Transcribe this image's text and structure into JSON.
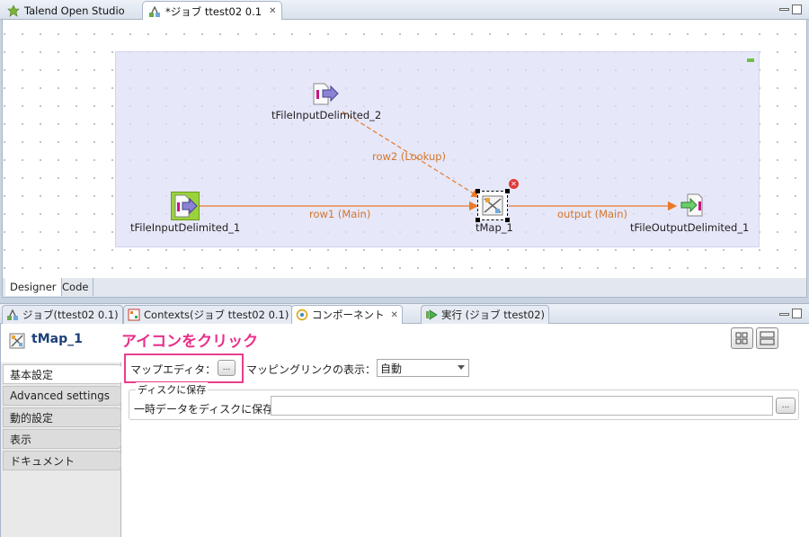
{
  "editor": {
    "tabs": [
      {
        "label": "Talend Open Studio",
        "icon": "talend-icon"
      },
      {
        "label": "*ジョブ ttest02 0.1",
        "icon": "job-icon"
      }
    ],
    "bottom_tabs": [
      {
        "label": "Designer"
      },
      {
        "label": "Code"
      }
    ]
  },
  "canvas": {
    "components": {
      "input2": "tFileInputDelimited_2",
      "input1": "tFileInputDelimited_1",
      "tmap": "tMap_1",
      "output": "tFileOutputDelimited_1"
    },
    "links": {
      "lookup": "row2 (Lookup)",
      "main": "row1 (Main)",
      "output": "output (Main)"
    }
  },
  "views": {
    "tabs": [
      {
        "label": "ジョブ(ttest02 0.1)",
        "icon": "job-icon"
      },
      {
        "label": "Contexts(ジョブ ttest02 0.1)",
        "icon": "contexts-icon"
      },
      {
        "label": "コンポーネント",
        "icon": "component-icon"
      },
      {
        "label": "実行 (ジョブ ttest02)",
        "icon": "run-icon"
      }
    ]
  },
  "component": {
    "title": "tMap_1",
    "annotation": "アイコンをクリック",
    "sidebar": [
      {
        "label": "基本設定"
      },
      {
        "label": "Advanced settings"
      },
      {
        "label": "動的設定"
      },
      {
        "label": "表示"
      },
      {
        "label": "ドキュメント"
      }
    ],
    "map_editor_label": "マップエディタ：",
    "map_editor_button": "...",
    "mapping_link_label": "マッピングリンクの表示：",
    "mapping_link_value": "自動",
    "disk_group_label": "ディスクに保存",
    "temp_data_label": "一時データをディスクに保存",
    "temp_data_value": "",
    "browse_button": "..."
  },
  "colors": {
    "link": "#e87a2a",
    "annotation": "#e8308a",
    "subjob_bg": "#dddef6",
    "title": "#1d3f78"
  }
}
